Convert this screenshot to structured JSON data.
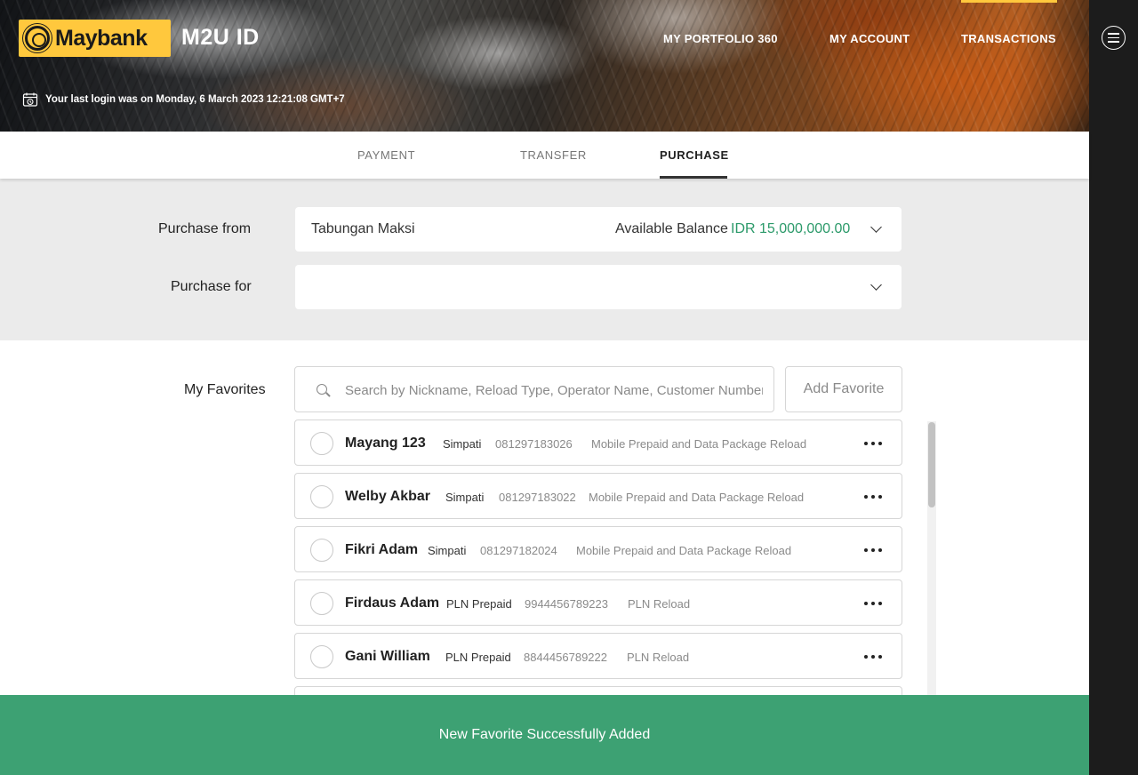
{
  "header": {
    "logo_text": "Maybank",
    "app_title": "M2U ID",
    "nav": {
      "portfolio": "MY PORTFOLIO 360",
      "account": "MY ACCOUNT",
      "transactions": "TRANSACTIONS"
    },
    "last_login": "Your last login was on Monday, 6 March 2023 12:21:08 GMT+7"
  },
  "tabs": {
    "payment": "PAYMENT",
    "transfer": "TRANSFER",
    "purchase": "PURCHASE",
    "active": "PURCHASE"
  },
  "form": {
    "purchase_from_label": "Purchase from",
    "purchase_from_value": "Tabungan Maksi",
    "balance_label": "Available Balance",
    "balance_value": "IDR 15,000,000.00",
    "purchase_for_label": "Purchase for",
    "purchase_for_value": ""
  },
  "favorites": {
    "label": "My Favorites",
    "search_placeholder": "Search by Nickname, Reload Type, Operator Name, Customer Number",
    "add_button": "Add Favorite",
    "items": [
      {
        "name": "Mayang 123",
        "type": "Simpati",
        "number": "081297183026",
        "desc": "Mobile Prepaid and Data Package Reload"
      },
      {
        "name": "Welby Akbar",
        "type": "Simpati",
        "number": "081297183022",
        "desc": "Mobile Prepaid and Data Package Reload"
      },
      {
        "name": "Fikri Adam",
        "type": "Simpati",
        "number": "081297182024",
        "desc": "Mobile Prepaid and Data Package Reload"
      },
      {
        "name": "Firdaus Adam",
        "type": "PLN Prepaid",
        "number": "9944456789223",
        "desc": "PLN Reload"
      },
      {
        "name": "Gani William",
        "type": "PLN Prepaid",
        "number": "8844456789222",
        "desc": "PLN Reload"
      }
    ]
  },
  "toast": {
    "message": "New Favorite Successfully Added"
  },
  "colors": {
    "brand_yellow": "#ffc83d",
    "success_green": "#3da173",
    "balance_green": "#2c9a6a"
  },
  "icons": [
    "maybank-logo-icon",
    "calendar-clock-icon",
    "hamburger-menu-icon",
    "chevron-down-icon",
    "search-icon",
    "more-horizontal-icon",
    "radio-icon"
  ]
}
